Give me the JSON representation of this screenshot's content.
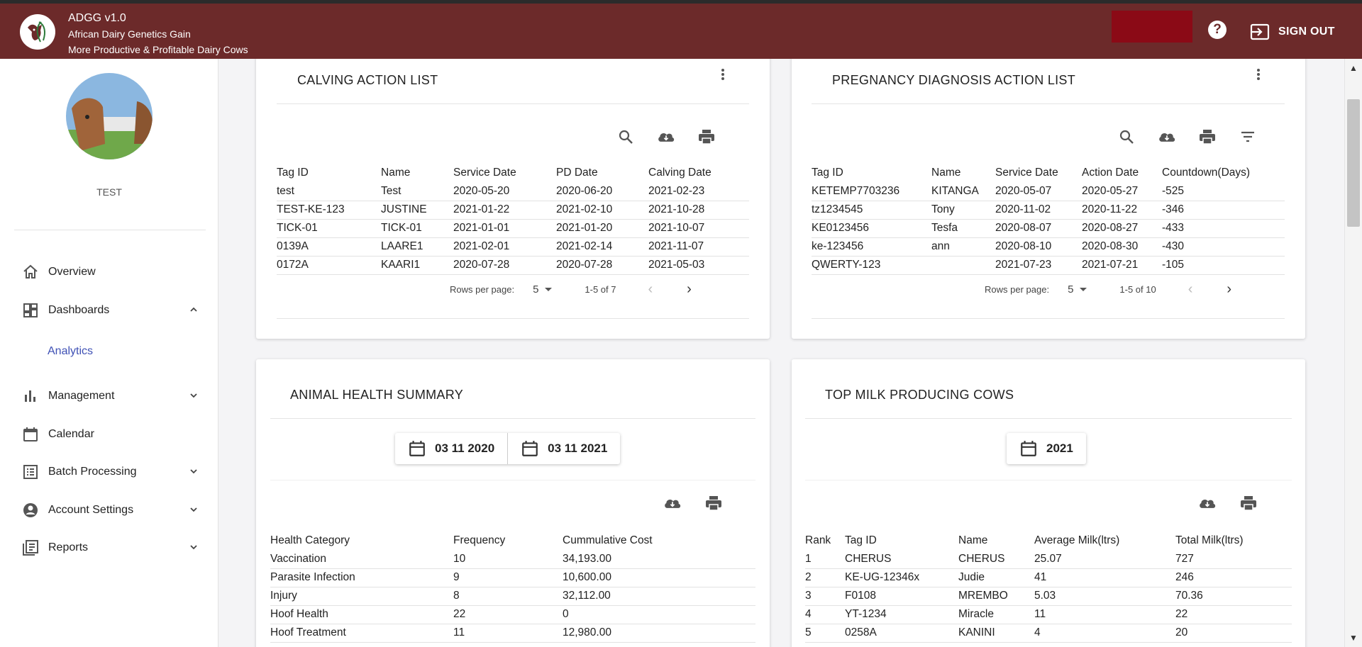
{
  "header": {
    "app_title": "ADGG v1.0",
    "subtitle": "African Dairy Genetics Gain",
    "tagline": "More Productive & Profitable Dairy Cows",
    "help_label": "?",
    "signout_label": "SIGN OUT",
    "accent_color": "#6c2a2a",
    "button_color": "#8b0a16"
  },
  "sidebar": {
    "username": "TEST",
    "items": [
      {
        "label": "Overview",
        "icon": "home-icon"
      },
      {
        "label": "Dashboards",
        "icon": "dashboard-icon"
      },
      {
        "label": "Management",
        "icon": "bar-chart-icon"
      },
      {
        "label": "Calendar",
        "icon": "calendar-icon"
      },
      {
        "label": "Batch Processing",
        "icon": "list-icon"
      },
      {
        "label": "Account Settings",
        "icon": "account-icon"
      },
      {
        "label": "Reports",
        "icon": "reports-icon"
      }
    ],
    "sub_item": "Analytics"
  },
  "calving": {
    "title": "CALVING ACTION LIST",
    "headers": [
      "Tag ID",
      "Name",
      "Service Date",
      "PD Date",
      "Calving Date"
    ],
    "rows": [
      [
        "test",
        "Test",
        "2020-05-20",
        "2020-06-20",
        "2021-02-23"
      ],
      [
        "TEST-KE-123",
        "JUSTINE",
        "2021-01-22",
        "2021-02-10",
        "2021-10-28"
      ],
      [
        "TICK-01",
        "TICK-01",
        "2021-01-01",
        "2021-01-20",
        "2021-10-07"
      ],
      [
        "0139A",
        "LAARE1",
        "2021-02-01",
        "2021-02-14",
        "2021-11-07"
      ],
      [
        "0172A",
        "KAARI1",
        "2020-07-28",
        "2020-07-28",
        "2021-05-03"
      ]
    ],
    "rows_per_page_label": "Rows per page:",
    "rows_per_page": "5",
    "range": "1-5 of 7"
  },
  "pregnancy": {
    "title": "PREGNANCY DIAGNOSIS ACTION LIST",
    "headers": [
      "Tag ID",
      "Name",
      "Service Date",
      "Action Date",
      "Countdown(Days)"
    ],
    "rows": [
      [
        "KETEMP7703236",
        "KITANGA",
        "2020-05-07",
        "2020-05-27",
        "-525"
      ],
      [
        "tz1234545",
        "Tony",
        "2020-11-02",
        "2020-11-22",
        "-346"
      ],
      [
        "KE0123456",
        "Tesfa",
        "2020-08-07",
        "2020-08-27",
        "-433"
      ],
      [
        "ke-123456",
        "ann",
        "2020-08-10",
        "2020-08-30",
        "-430"
      ],
      [
        "QWERTY-123",
        "",
        "2021-07-23",
        "2021-07-21",
        "-105"
      ]
    ],
    "rows_per_page_label": "Rows per page:",
    "rows_per_page": "5",
    "range": "1-5 of 10"
  },
  "health": {
    "title": "ANIMAL HEALTH SUMMARY",
    "date_from": "03 11 2020",
    "date_to": "03 11 2021",
    "headers": [
      "Health Category",
      "Frequency",
      "Cummulative Cost"
    ],
    "rows": [
      [
        "Vaccination",
        "10",
        "34,193.00"
      ],
      [
        "Parasite Infection",
        "9",
        "10,600.00"
      ],
      [
        "Injury",
        "8",
        "32,112.00"
      ],
      [
        "Hoof Health",
        "22",
        "0"
      ],
      [
        "Hoof Treatment",
        "11",
        "12,980.00"
      ]
    ]
  },
  "milk": {
    "title": "TOP MILK PRODUCING COWS",
    "year": "2021",
    "headers": [
      "Rank",
      "Tag ID",
      "Name",
      "Average Milk(ltrs)",
      "Total Milk(ltrs)"
    ],
    "rows": [
      [
        "1",
        "CHERUS",
        "CHERUS",
        "25.07",
        "727"
      ],
      [
        "2",
        "KE-UG-12346x",
        "Judie",
        "41",
        "246"
      ],
      [
        "3",
        "F0108",
        "MREMBO",
        "5.03",
        "70.36"
      ],
      [
        "4",
        "YT-1234",
        "Miracle",
        "11",
        "22"
      ],
      [
        "5",
        "0258A",
        "KANINI",
        "4",
        "20"
      ]
    ]
  }
}
